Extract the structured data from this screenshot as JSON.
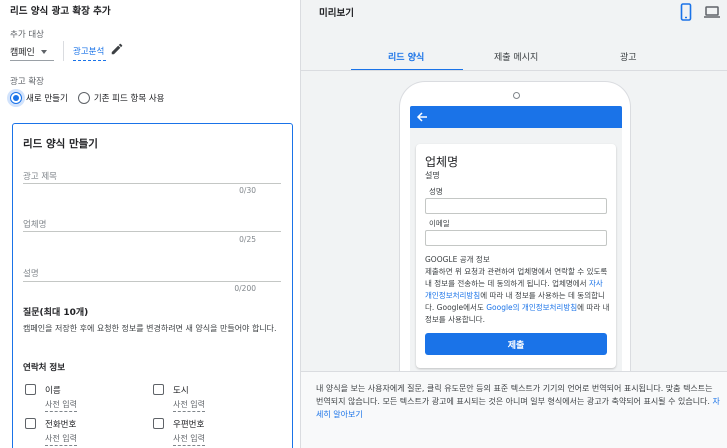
{
  "left": {
    "title": "리드 양식 광고 확장 추가",
    "target_label": "추가 대상",
    "target_value": "캠페인",
    "campaign_link": "광고분석",
    "extension_label": "광고 확장",
    "radio_new": "새로 만들기",
    "radio_existing": "기존 피드 항목 사용",
    "card": {
      "title": "리드 양식 만들기",
      "fields": [
        {
          "placeholder": "광고 제목",
          "count": "0/30"
        },
        {
          "placeholder": "업체명",
          "count": "0/25"
        },
        {
          "placeholder": "설명",
          "count": "0/200"
        }
      ],
      "questions_title": "질문(최대 10개)",
      "questions_desc": "캠페인을 저장한 후에 요청한 정보를 변경하려면 새 양식을 만들어야 합니다.",
      "contact_title": "연락처 정보",
      "checkboxes": [
        {
          "label": "이름",
          "sub": "사전 입력"
        },
        {
          "label": "도시",
          "sub": "사전 입력"
        },
        {
          "label": "전화번호",
          "sub": "사전 입력"
        },
        {
          "label": "우편번호",
          "sub": "사전 입력"
        }
      ]
    }
  },
  "preview": {
    "title": "미리보기",
    "tabs": [
      "리드 양식",
      "제출 메시지",
      "광고"
    ],
    "active_tab": 0,
    "phone": {
      "business_name": "업체명",
      "description": "설명",
      "name_label": "성명",
      "email_label": "이메일",
      "google_title": "GOOGLE 공개 정보",
      "google_text_1": "제출하면 위 요청과 관련하여 업체명에서 연락할 수 있도록 내 정보를 전송하는 데 동의하게 됩니다. 업체명에서 ",
      "google_link_1": "자사 개인정보처리방침",
      "google_text_2": "에 따라 내 정보를 사용하는 데 동의합니다. Google에서도 ",
      "google_link_2": "Google의 개인정보처리방침",
      "google_text_3": "에 따라 내 정보를 사용합니다.",
      "submit": "제출"
    },
    "notice_text": "내 양식을 보는 사용자에게 질문, 클릭 유도문안 등의 표준 텍스트가 기기의 언어로 번역되어 표시됩니다. 맞춤 텍스트는 번역되지 않습니다. 모든 텍스트가 광고에 표시되는 것은 아니며 일부 형식에서는 광고가 축약되어 표시될 수 있습니다. ",
    "notice_link": "자세히 알아보기"
  },
  "colors": {
    "accent": "#1a73e8",
    "text": "#202124",
    "muted": "#5f6368"
  },
  "icons": [
    "chevron-down-icon",
    "pencil-icon",
    "phone-device-icon",
    "laptop-device-icon",
    "back-arrow-icon"
  ]
}
